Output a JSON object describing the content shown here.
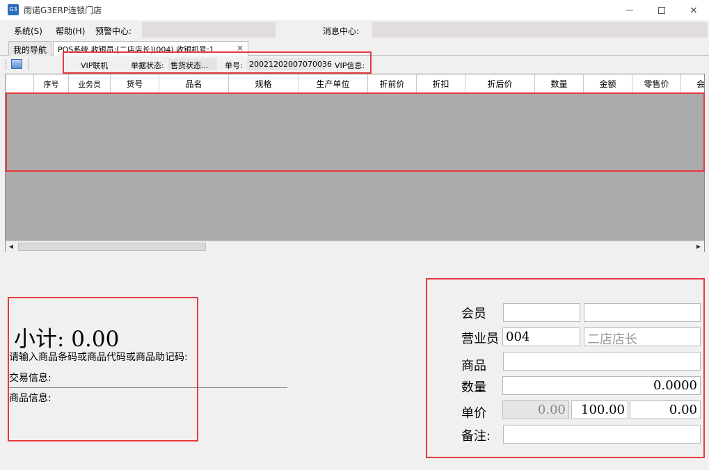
{
  "window": {
    "app_icon_text": "G3",
    "title": "雨诺G3ERP连锁门店",
    "controls": {
      "minimize": "",
      "maximize": "",
      "close": "×"
    }
  },
  "menu": {
    "system": "系统(S)",
    "help": "帮助(H)",
    "alert_center": "预警中心:",
    "message_center": "消息中心:"
  },
  "tabs": [
    {
      "label": "我的导航"
    },
    {
      "label": "POS系统 收银员:[二店店长](004) 收银机号:1",
      "close": "×"
    }
  ],
  "toolbar": {
    "vip_online": "VIP联机",
    "doc_status_label": "单据状态:",
    "doc_status_value": "售货状态...",
    "doc_no_label": "单号:",
    "doc_no_value": "20021202007070036",
    "vip_info_label": "VIP信息:"
  },
  "grid": {
    "columns": [
      "序号",
      "业务员",
      "货号",
      "品名",
      "规格",
      "生产单位",
      "折前价",
      "折扣",
      "折后价",
      "数量",
      "金额",
      "零售价",
      "会"
    ],
    "rows": []
  },
  "scrollbar": {
    "left_arrow": "◀",
    "right_arrow": "▶"
  },
  "summary": {
    "subtotal": "小计: 0.00",
    "prompt": "请输入商品条码或商品代码或商品助记码:",
    "trade_info": "交易信息:",
    "goods_info": "商品信息:"
  },
  "form": {
    "member_label": "会员",
    "member_code": "",
    "member_name": "",
    "clerk_label": "营业员",
    "clerk_code": "004",
    "clerk_name": "二店店长",
    "goods_label": "商品",
    "goods_value": "",
    "qty_label": "数量",
    "qty_value": "0.0000",
    "price_label": "单价",
    "price_original": "0.00",
    "price_value": "100.00",
    "price_extra": "0.00",
    "remark_label": "备注:",
    "remark_value": ""
  }
}
